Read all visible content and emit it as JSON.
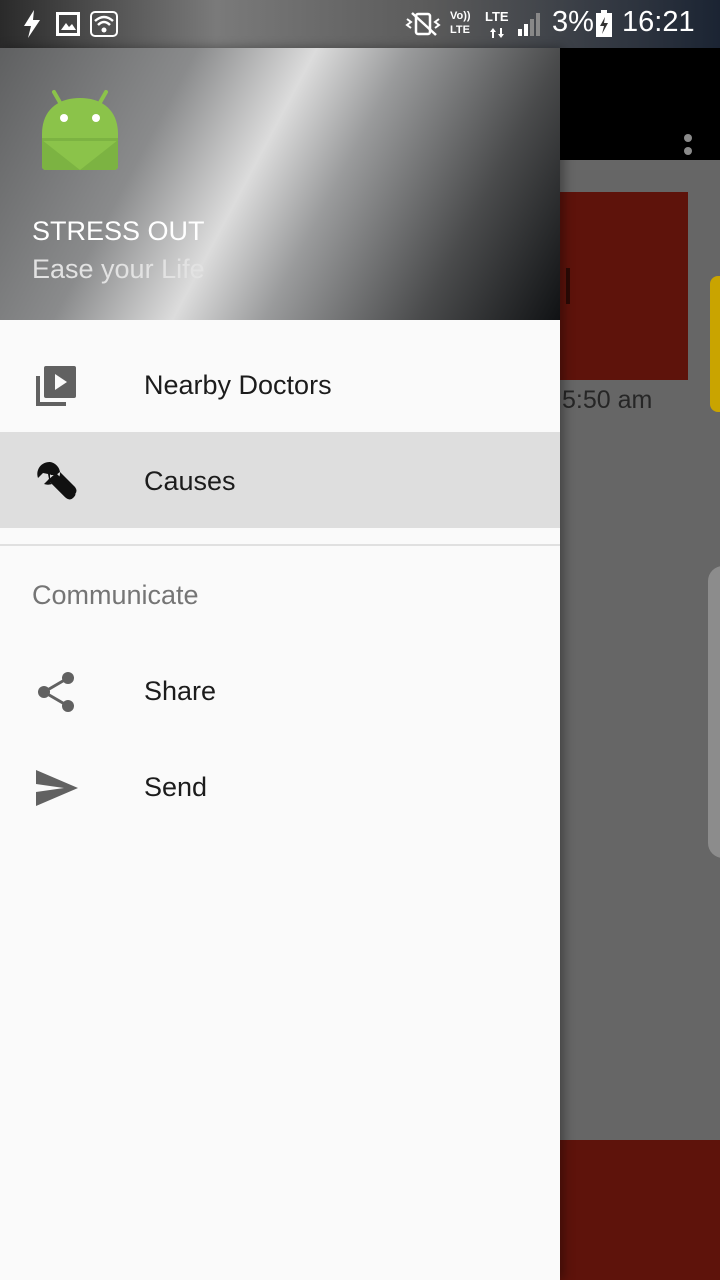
{
  "status_bar": {
    "volte_label": "Vo))",
    "lte_label_1": "LTE",
    "lte_label_2": "LTE",
    "battery_text": "3%",
    "time": "16:21"
  },
  "background_app": {
    "time_text": "5:50 am"
  },
  "drawer": {
    "header": {
      "app_name": "STRESS OUT",
      "tagline": "Ease your Life"
    },
    "items": [
      {
        "label": "Nearby Doctors",
        "icon": "video-library-icon",
        "selected": false
      },
      {
        "label": "Causes",
        "icon": "wrench-icon",
        "selected": true
      }
    ],
    "section": {
      "title": "Communicate",
      "items": [
        {
          "label": "Share",
          "icon": "share-icon"
        },
        {
          "label": "Send",
          "icon": "send-icon"
        }
      ]
    }
  },
  "colors": {
    "selected_bg": "#dedede",
    "drawer_bg": "#fafafa",
    "android_green": "#8bc34a",
    "card_red": "#5e130b"
  }
}
